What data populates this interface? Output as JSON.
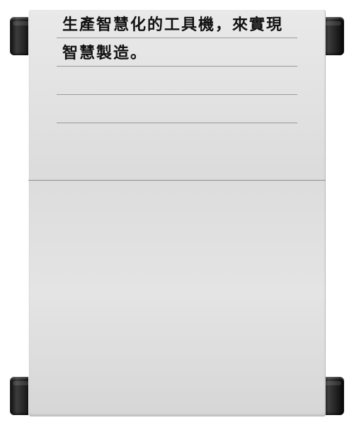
{
  "sign": {
    "lines": [
      "生產智慧化的工具機，來實現",
      "智慧製造。",
      "",
      ""
    ]
  }
}
